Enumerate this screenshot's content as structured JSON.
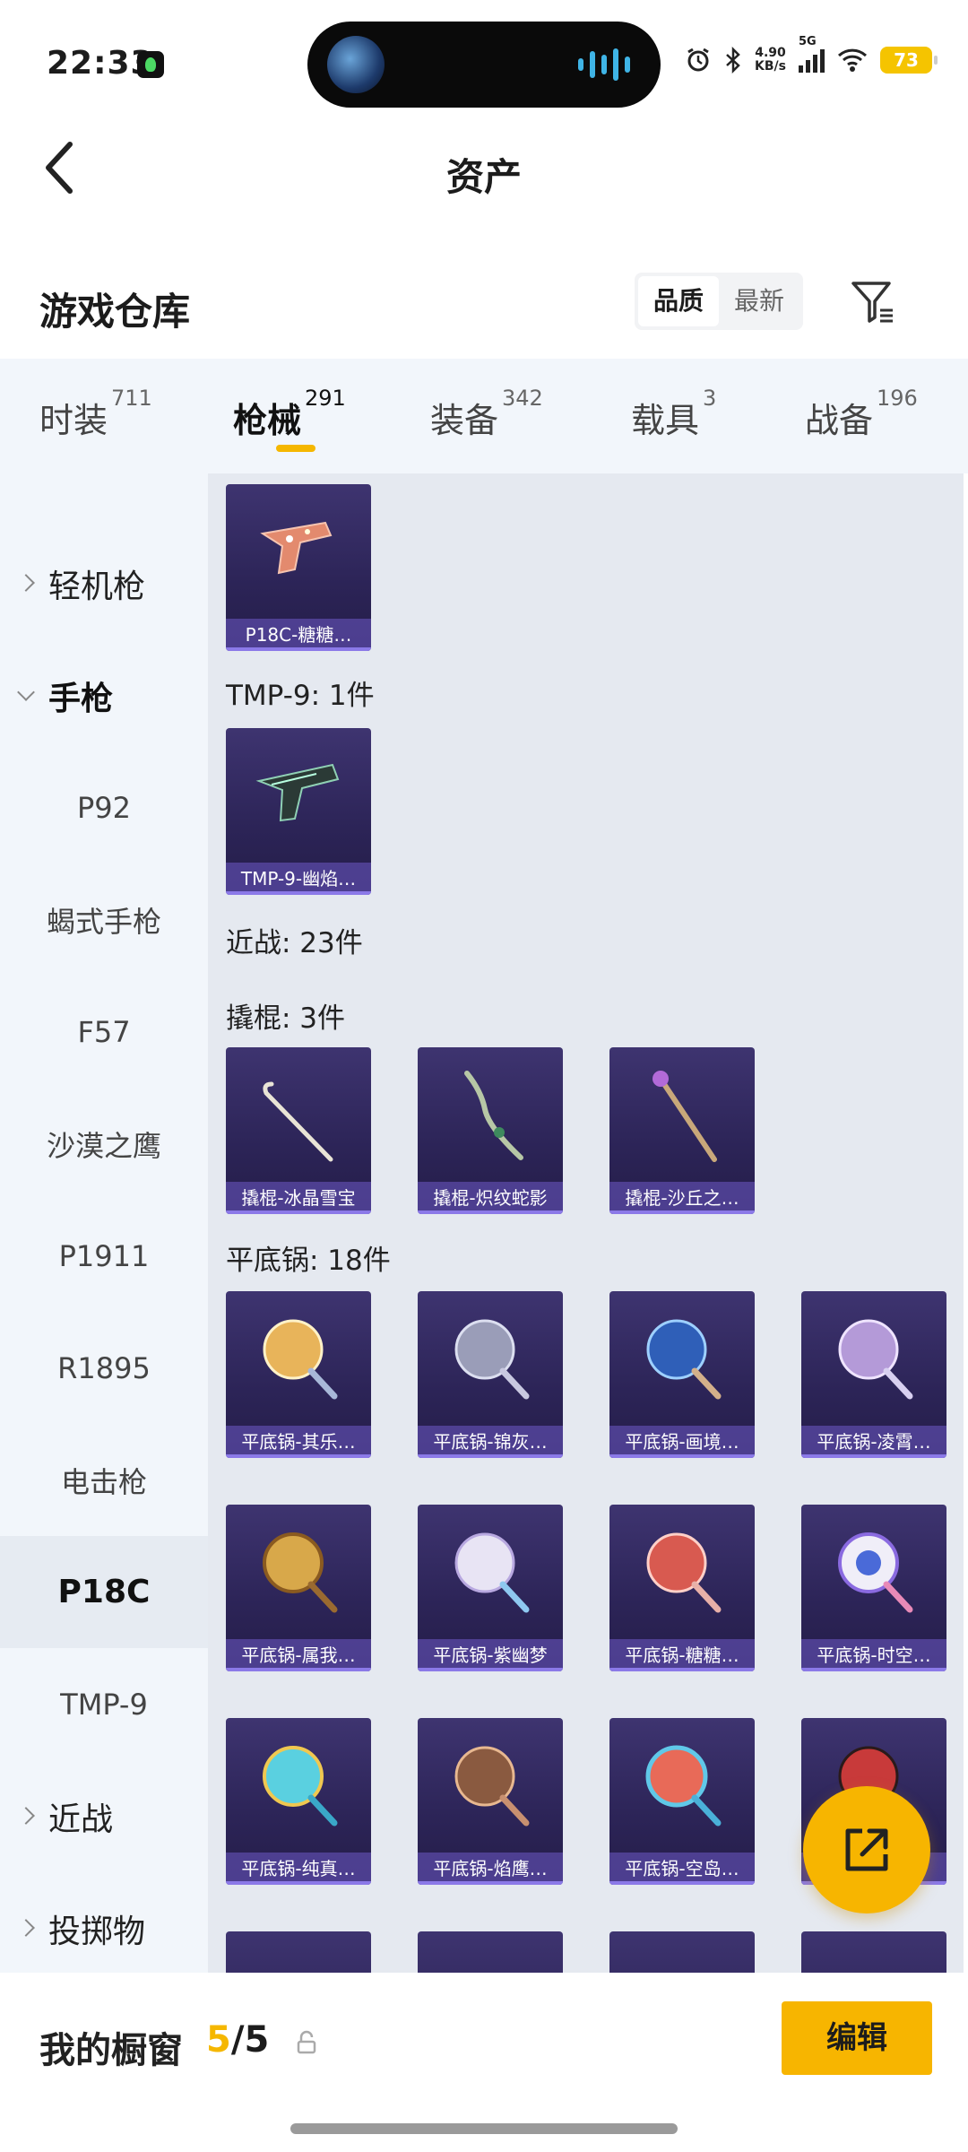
{
  "status_bar": {
    "time": "22:33",
    "net_speed_value": "4.90",
    "net_speed_unit": "KB/s",
    "network_type": "5G",
    "battery": "73",
    "icons": [
      "alarm-icon",
      "bluetooth-icon",
      "signal-icon",
      "wifi-icon",
      "battery-icon"
    ]
  },
  "header": {
    "title": "资产"
  },
  "section": {
    "title": "游戏仓库",
    "sort_options": [
      {
        "label": "品质",
        "active": true
      },
      {
        "label": "最新",
        "active": false
      }
    ]
  },
  "tabs": [
    {
      "label": "时装",
      "count": "711"
    },
    {
      "label": "枪械",
      "count": "291",
      "active": true
    },
    {
      "label": "装备",
      "count": "342"
    },
    {
      "label": "载具",
      "count": "3"
    },
    {
      "label": "战备",
      "count": "196"
    }
  ],
  "sidebar": {
    "items": [
      {
        "label": "轻机枪",
        "type": "group",
        "expanded": false
      },
      {
        "label": "手枪",
        "type": "group",
        "expanded": true
      },
      {
        "label": "P92",
        "type": "child"
      },
      {
        "label": "蝎式手枪",
        "type": "child"
      },
      {
        "label": "F57",
        "type": "child"
      },
      {
        "label": "沙漠之鹰",
        "type": "child"
      },
      {
        "label": "P1911",
        "type": "child"
      },
      {
        "label": "R1895",
        "type": "child"
      },
      {
        "label": "电击枪",
        "type": "child"
      },
      {
        "label": "P18C",
        "type": "child",
        "selected": true
      },
      {
        "label": "TMP-9",
        "type": "child"
      },
      {
        "label": "近战",
        "type": "group",
        "expanded": false
      },
      {
        "label": "投掷物",
        "type": "group",
        "expanded": false
      }
    ]
  },
  "content": {
    "groups": [
      {
        "heading": "",
        "items": [
          "P18C-糖糖…"
        ]
      },
      {
        "heading": "TMP-9: 1件",
        "items": [
          "TMP-9-幽焰…"
        ]
      },
      {
        "heading": "近战: 23件",
        "items": []
      },
      {
        "heading": "撬棍: 3件",
        "items": [
          "撬棍-冰晶雪宝",
          "撬棍-炽纹蛇影",
          "撬棍-沙丘之…"
        ]
      },
      {
        "heading": "平底锅: 18件",
        "items": [
          "平底锅-其乐…",
          "平底锅-锦灰…",
          "平底锅-画境…",
          "平底锅-凌霄…",
          "平底锅-属我…",
          "平底锅-紫幽梦",
          "平底锅-糖糖…",
          "平底锅-时空…",
          "平底锅-纯真…",
          "平底锅-焰鹰…",
          "平底锅-空岛…",
          "",
          "",
          "",
          "",
          ""
        ]
      }
    ]
  },
  "bottom_bar": {
    "showcase_label": "我的橱窗",
    "showcase_current": "5",
    "showcase_total": "/5",
    "edit_label": "编辑"
  },
  "colors": {
    "accent": "#f7b500",
    "card_bg": "#2c2457",
    "card_label_bg": "#6e5ac8",
    "sidebar_bg": "#f2f6fb",
    "content_bg": "#e5e9f0"
  }
}
